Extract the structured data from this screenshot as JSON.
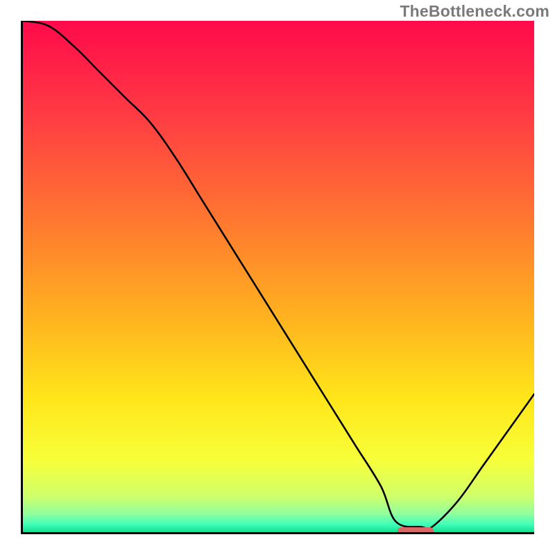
{
  "watermark": "TheBottleneck.com",
  "chart_data": {
    "type": "line",
    "title": "",
    "xlabel": "",
    "ylabel": "",
    "xlim": [
      0,
      100
    ],
    "ylim": [
      0,
      100
    ],
    "x": [
      0,
      5,
      10,
      15,
      20,
      25,
      30,
      35,
      40,
      45,
      50,
      55,
      60,
      65,
      70,
      73,
      78,
      80,
      85,
      90,
      95,
      100
    ],
    "values": [
      100,
      99,
      95,
      90,
      85,
      80,
      73,
      65,
      57,
      49,
      41,
      33,
      25,
      17,
      9,
      2,
      1,
      1,
      6,
      13,
      20,
      27
    ],
    "marker": {
      "x_start": 73,
      "x_end": 80,
      "y": 0.6
    },
    "gradient_stops": [
      {
        "offset": 0.0,
        "color": "#ff0a4a"
      },
      {
        "offset": 0.18,
        "color": "#ff3a44"
      },
      {
        "offset": 0.4,
        "color": "#ff7a2f"
      },
      {
        "offset": 0.58,
        "color": "#ffb21f"
      },
      {
        "offset": 0.74,
        "color": "#ffe61a"
      },
      {
        "offset": 0.86,
        "color": "#f7ff3a"
      },
      {
        "offset": 0.93,
        "color": "#cfff6a"
      },
      {
        "offset": 0.965,
        "color": "#8fff9f"
      },
      {
        "offset": 0.985,
        "color": "#3fffb8"
      },
      {
        "offset": 1.0,
        "color": "#10e090"
      }
    ]
  }
}
